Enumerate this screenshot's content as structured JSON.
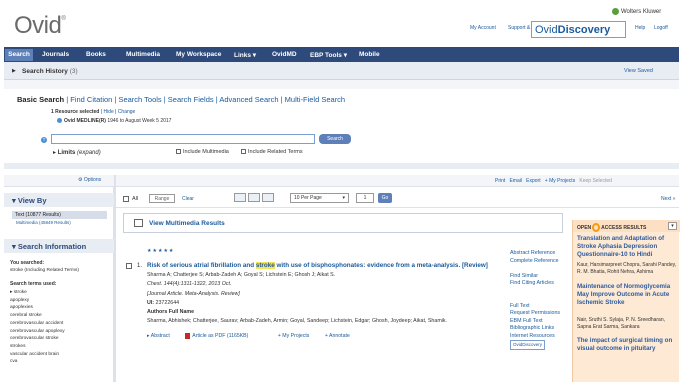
{
  "header": {
    "logo": "Ovid",
    "logo_mark": "®",
    "brand": "Wolters Kluwer",
    "my_account": "My Account",
    "support": "Support & Training",
    "ovid_discovery_a": "Ovid",
    "ovid_discovery_b": "Discovery",
    "help": "Help",
    "logoff": "Logoff"
  },
  "nav": {
    "search": "Search",
    "journals": "Journals",
    "books": "Books",
    "multimedia": "Multimedia",
    "workspace": "My Workspace",
    "links": "Links ▾",
    "ovidmd": "OvidMD",
    "ebp": "EBP Tools ▾",
    "mobile": "Mobile"
  },
  "history": {
    "label": "Search History",
    "count": "(3)",
    "view_saved": "View Saved"
  },
  "search": {
    "tab_basic": "Basic Search",
    "tab_others": " | Find Citation | Search Tools | Search Fields | Advanced Search | Multi-Field Search",
    "resource_selected": "1 Resource selected",
    "hide": "Hide",
    "change": "Change",
    "db": "Ovid MEDLINE(R)",
    "db_range": " 1946 to August Week 5 2017",
    "button": "Search",
    "limits": "Limits",
    "limits_expand": "(expand)",
    "include_multimedia": "Include Multimedia",
    "include_related": "Include Related Terms"
  },
  "sidebar": {
    "options": "Options",
    "view_by": "View By",
    "text_results": "Text (10877 Results)",
    "mm_results": "Multimedia (45849 Results)",
    "search_info": "Search Information",
    "you_searched": "You searched:",
    "you_searched_value": "stroke (Including Related Terms)",
    "terms_used": "Search terms used:",
    "terms": [
      "▸ stroke",
      "apoplexy",
      "apoplexies",
      "cerebral stroke",
      "cerebrovascular accident",
      "cerebrovascular apoplexy",
      "cerebrovascular stroke",
      "strokes",
      "vascular accident brain",
      "cva"
    ]
  },
  "toolbar": {
    "print": "Print",
    "email": "Email",
    "export": "Export",
    "my_projects": "+ My Projects",
    "keep_selected": "Keep Selected",
    "all": "All",
    "range": "Range",
    "clear": "Clear",
    "per_page": "10 Per Page",
    "page": "1",
    "go": "Go",
    "next": "Next »"
  },
  "multimedia_box": "View Multimedia Results",
  "record": {
    "stars": "★★★★★",
    "num": "1.",
    "title_a": "Risk of serious atrial fibrillation and ",
    "title_hl": "stroke",
    "title_b": " with use of bisphosphonates: evidence from a meta-analysis. [Review]",
    "authors": "Sharma A; Chatterjee S; Arbab-Zadeh A; Goyal S; Lichstein E; Ghosh J; Aikat S.",
    "source": "Chest. 144(4):1311-1322, 2013 Oct.",
    "type": "[Journal Article. Meta-Analysis. Review]",
    "ui_label": "UI:",
    "ui": " 23722644",
    "afn_h": "Authors Full Name",
    "afn": "Sharma, Abhishek; Chatterjee, Saurav; Arbab-Zadeh, Armin; Goyal, Sandeep; Lichstein, Edgar; Ghosh, Joydeep; Aikat, Shamik.",
    "abstract": "▸ Abstract",
    "pdf": "Article as PDF (1165KB)",
    "projects": "+ My Projects",
    "annotate": "+ Annotate",
    "links": [
      "Abstract Reference",
      "Complete Reference",
      "",
      "Find Similar",
      "Find Citing Articles",
      "",
      "",
      "Full Text",
      "Request Permissions",
      "EBM Full Text",
      "Bibliographic Links",
      "Internet Resources"
    ],
    "ovid_disc_small": "OvidDiscovery"
  },
  "open_access": {
    "head_a": "OPEN",
    "head_b": "ACCESS RESULTS",
    "items": [
      {
        "title": "Translation and Adaptation of Stroke Aphasia Depression Questionnaire-10 to Hindi",
        "authors": "Kaur, Harsimarpreet Chopra, Sarahi Pandey, R. M. Bhatia, Rohit Nehra, Ashima"
      },
      {
        "title": "Maintenance of Normoglycemia May Improve Outcome in Acute Ischemic Stroke",
        "authors": "Nair, Sruthi S. Sylaja, P. N. Sreedharan, Sapna Erat Sarma, Sankara"
      },
      {
        "title": "The impact of surgical timing on visual outcome in pituitary",
        "authors": ""
      }
    ]
  }
}
